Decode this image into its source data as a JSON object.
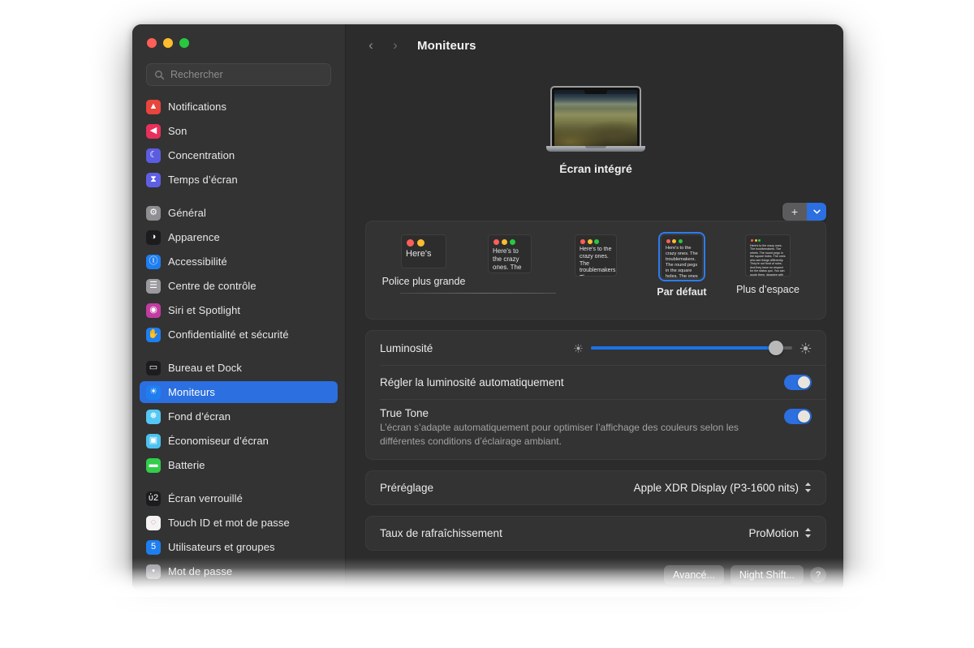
{
  "window": {
    "traffic_lights": [
      "close",
      "minimize",
      "zoom"
    ],
    "title": "Moniteurs"
  },
  "search": {
    "placeholder": "Rechercher",
    "value": "",
    "icon": "search-icon"
  },
  "sidebar": {
    "groups": [
      {
        "items": [
          {
            "label": "Notifications",
            "icon": "notifications-icon",
            "color": "#e8453c",
            "glyph": "▲",
            "selected": false
          },
          {
            "label": "Son",
            "icon": "sound-icon",
            "color": "#e8305a",
            "glyph": "◀",
            "selected": false
          },
          {
            "label": "Concentration",
            "icon": "focus-icon",
            "color": "#5b5ce0",
            "glyph": "☾",
            "selected": false
          },
          {
            "label": "Temps d’écran",
            "icon": "screen-time-icon",
            "color": "#5f5fe6",
            "glyph": "⧗",
            "selected": false
          }
        ]
      },
      {
        "items": [
          {
            "label": "Général",
            "icon": "general-icon",
            "color": "#8e8e93",
            "glyph": "⚙",
            "selected": false
          },
          {
            "label": "Apparence",
            "icon": "appearance-icon",
            "color": "#1c1c1e",
            "glyph": "◑",
            "selected": false
          },
          {
            "label": "Accessibilité",
            "icon": "accessibility-icon",
            "color": "#1e7ef0",
            "glyph": "Ⓘ",
            "selected": false
          },
          {
            "label": "Centre de contrôle",
            "icon": "control-center-icon",
            "color": "#9a9a9f",
            "glyph": "☰",
            "selected": false
          },
          {
            "label": "Siri et Spotlight",
            "icon": "siri-icon",
            "color": "#c23ca0",
            "glyph": "◉",
            "selected": false
          },
          {
            "label": "Confidentialité et sécurité",
            "icon": "privacy-icon",
            "color": "#1e7ef0",
            "glyph": "✋",
            "selected": false
          }
        ]
      },
      {
        "items": [
          {
            "label": "Bureau et Dock",
            "icon": "desktop-dock-icon",
            "color": "#1c1c1e",
            "glyph": "▭",
            "selected": false
          },
          {
            "label": "Moniteurs",
            "icon": "displays-icon",
            "color": "#1e7ef0",
            "glyph": "☀",
            "selected": true
          },
          {
            "label": "Fond d’écran",
            "icon": "wallpaper-icon",
            "color": "#54c7f5",
            "glyph": "❅",
            "selected": false
          },
          {
            "label": "Économiseur d’écran",
            "icon": "screen-saver-icon",
            "color": "#4cc2f0",
            "glyph": "▣",
            "selected": false
          },
          {
            "label": "Batterie",
            "icon": "battery-icon",
            "color": "#32cd4a",
            "glyph": "▬",
            "selected": false
          }
        ]
      },
      {
        "items": [
          {
            "label": "Écran verrouillé",
            "icon": "lock-screen-icon",
            "color": "#1c1c1e",
            "glyph": "ὑ2",
            "selected": false
          },
          {
            "label": "Touch ID et mot de passe",
            "icon": "touch-id-icon",
            "color": "#f3f3f3",
            "glyph": "◌",
            "selected": false
          },
          {
            "label": "Utilisateurs et groupes",
            "icon": "users-groups-icon",
            "color": "#1e7ef0",
            "glyph": "὆5",
            "selected": false
          },
          {
            "label": "Mot de passe",
            "icon": "passwords-icon",
            "color": "#9a9a9f",
            "glyph": "•",
            "selected": false
          }
        ]
      }
    ]
  },
  "toolbar": {
    "back": "‹",
    "forward": "›",
    "title": "Moniteurs"
  },
  "display": {
    "name": "Écran intégré",
    "add_button_label": "+",
    "add_chevron": "⌄"
  },
  "scaling": {
    "options": [
      {
        "label": "Police plus grande",
        "bold": false,
        "selected": false,
        "preview_text": "Here's",
        "dots": 2,
        "tw": 56,
        "th": 42,
        "fs": 11
      },
      {
        "label": "",
        "bold": false,
        "selected": false,
        "preview_text": "Here's to the crazy ones. The troublemakers.",
        "dots": 3,
        "tw": 54,
        "th": 48,
        "fs": 8
      },
      {
        "label": "",
        "bold": false,
        "selected": false,
        "preview_text": "Here's to the crazy ones. The troublemakers. The ones who see things differently.",
        "dots": 3,
        "tw": 52,
        "th": 52,
        "fs": 7
      },
      {
        "label": "Par défaut",
        "bold": true,
        "selected": true,
        "preview_text": "Here's to the crazy ones. The troublemakers. The round pegs in the square holes. The ones who see things differently. They're not fond of rules. And they have no respect for the status quo.",
        "dots": 3,
        "tw": 52,
        "th": 55,
        "fs": 5.6
      },
      {
        "label": "Plus d’espace",
        "bold": false,
        "selected": false,
        "preview_text": "Here's to the crazy ones. The troublemakers. The rebels. The round pegs in the square holes. The ones who see things differently. They're not fond of rules. And they have no respect for the status quo. You can quote them, disagree with them, glorify or vilify them. About the only thing you can't do is ignore them. Because they change things.",
        "dots": 3,
        "tw": 56,
        "th": 52,
        "fs": 3.6
      }
    ]
  },
  "brightness": {
    "label": "Luminosité",
    "value_percent": 92,
    "low_icon": "sun-small-icon",
    "high_icon": "sun-large-icon",
    "auto_label": "Régler la luminosité automatiquement",
    "auto_on": true,
    "true_tone_label": "True Tone",
    "true_tone_desc": "L’écran s’adapte automatiquement pour optimiser l’affichage des couleurs selon les différentes conditions d’éclairage ambiant.",
    "true_tone_on": true
  },
  "preset": {
    "label": "Préréglage",
    "value": "Apple XDR Display (P3-1600 nits)"
  },
  "refresh": {
    "label": "Taux de rafraîchissement",
    "value": "ProMotion"
  },
  "footer": {
    "advanced": "Avancé...",
    "night_shift": "Night Shift...",
    "help": "?"
  },
  "colors": {
    "accent": "#2b6fe0",
    "slider_fill": "#1a73e8",
    "window_bg": "#2c2c2c",
    "sidebar_bg": "#333333",
    "card_bg": "#333333"
  }
}
